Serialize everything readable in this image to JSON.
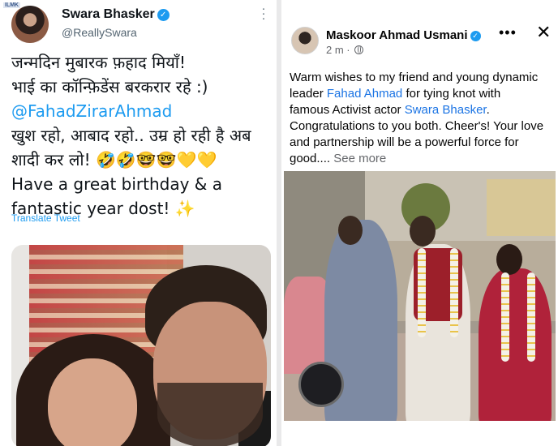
{
  "tweet": {
    "avatar_tag": "ILMK",
    "author_name": "Swara Bhasker",
    "handle": "@ReallySwara",
    "verified_glyph": "✓",
    "more_icon": "vertical-ellipsis-icon",
    "lines": [
      "जन्मदिन मुबारक फ़हाद मियाँ!",
      "भाई का कॉन्फ़िडेंस बरकरार रहे :)",
      "@FahadZirarAhmad",
      "खुश रहो, आबाद रहो..  उम्र हो रही है अब",
      "शादी कर लो! 🤣🤣🤓🤓💛💛",
      "Have a great birthday & a",
      "fantastic year dost! ✨"
    ],
    "translate_label": "Translate Tweet"
  },
  "fb_post": {
    "author_name": "Maskoor Ahmad Usmani",
    "verified_glyph": "✓",
    "timestamp": "2 m ·",
    "globe_icon": "globe-icon",
    "more_label": "•••",
    "close_label": "✕",
    "text": {
      "l1": "Warm wishes to my friend and young dynamic",
      "l2_pre": "leader ",
      "l2_link": "Fahad Ahmad",
      "l2_post": " for tying knot with",
      "l3_pre": "famous Activist actor ",
      "l3_link": "Swara Bhasker",
      "l3_post": ".",
      "l4": "Congratulations to you both. Cheer's! Your love",
      "l5": "and partnership will be a powerful force for",
      "l6_pre": "good.... ",
      "see_more": "See more"
    }
  },
  "colors": {
    "link_blue": "#1d9bf0",
    "fb_link_blue": "#1b74e4",
    "muted_gray": "#536471",
    "verified_blue": "#1d9bf0"
  }
}
